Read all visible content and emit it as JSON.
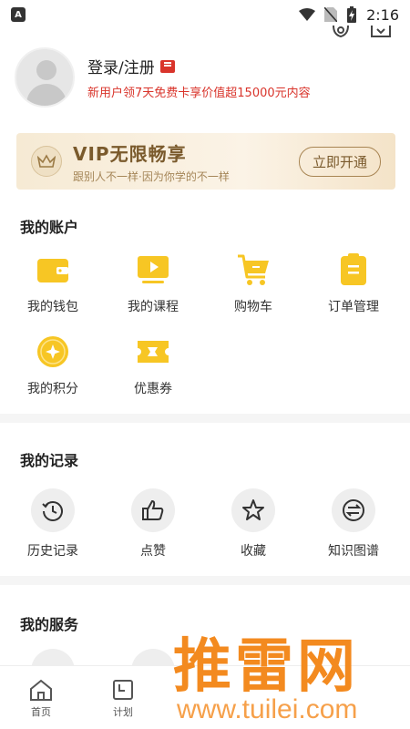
{
  "status_bar": {
    "time": "2:16"
  },
  "profile": {
    "login_label": "登录/注册",
    "promo": "新用户领7天免费卡享价值超15000元内容"
  },
  "vip_banner": {
    "title": "VIP无限畅享",
    "subtitle": "跟别人不一样·因为你学的不一样",
    "button": "立即开通"
  },
  "account": {
    "title": "我的账户",
    "items": [
      {
        "label": "我的钱包",
        "icon": "wallet-icon"
      },
      {
        "label": "我的课程",
        "icon": "course-icon"
      },
      {
        "label": "购物车",
        "icon": "cart-icon"
      },
      {
        "label": "订单管理",
        "icon": "order-icon"
      },
      {
        "label": "我的积分",
        "icon": "points-icon"
      },
      {
        "label": "优惠券",
        "icon": "coupon-icon"
      }
    ]
  },
  "records": {
    "title": "我的记录",
    "items": [
      {
        "label": "历史记录",
        "icon": "history-icon"
      },
      {
        "label": "点赞",
        "icon": "thumbs-up-icon"
      },
      {
        "label": "收藏",
        "icon": "star-icon"
      },
      {
        "label": "知识图谱",
        "icon": "knowledge-map-icon"
      }
    ]
  },
  "services": {
    "title": "我的服务"
  },
  "bottom_nav": [
    {
      "label": "首页",
      "icon": "home-icon"
    },
    {
      "label": "计划",
      "icon": "plan-icon"
    }
  ],
  "watermark": {
    "brand": "推雷网",
    "url": "www.tuilei.com"
  },
  "colors": {
    "accent_yellow": "#f7c624",
    "promo_red": "#d9342b",
    "vip_gold": "#7a5a2c"
  }
}
